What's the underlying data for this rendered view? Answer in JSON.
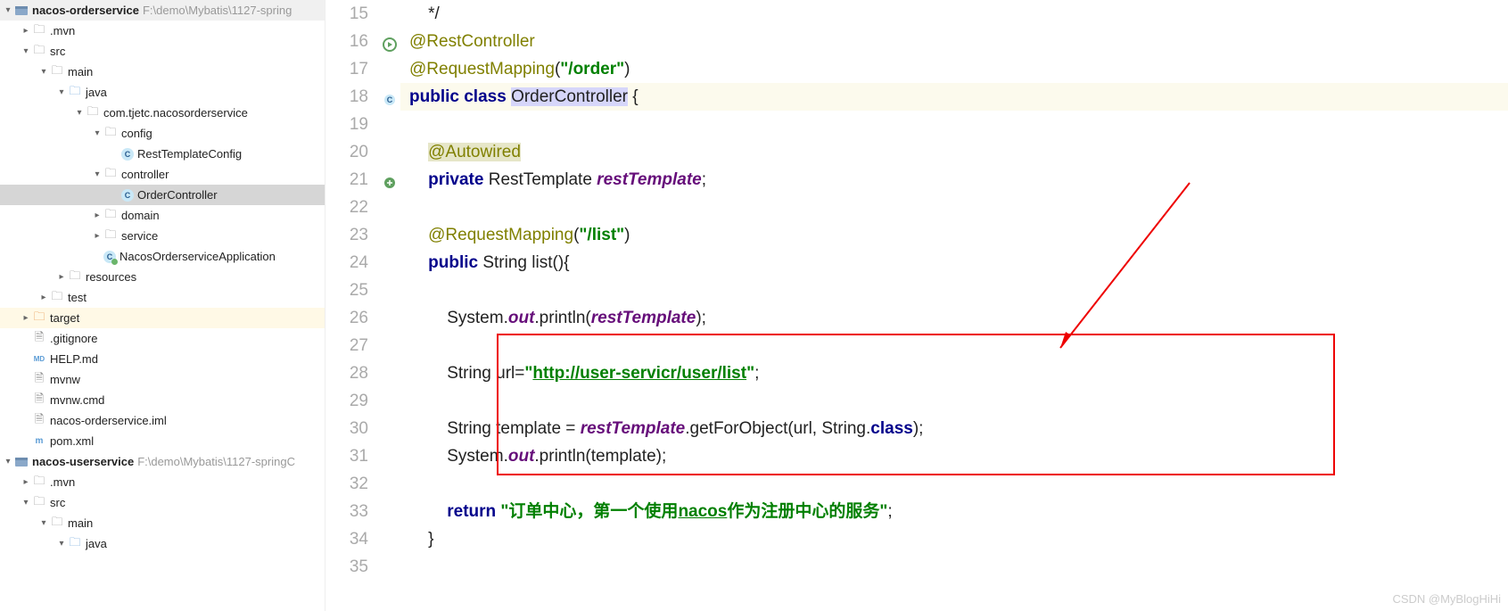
{
  "tree": {
    "proj1": {
      "name": "nacos-orderservice",
      "path": "F:\\demo\\Mybatis\\1127-spring"
    },
    "mvn": ".mvn",
    "src": "src",
    "main": "main",
    "java": "java",
    "pkg": "com.tjetc.nacosorderservice",
    "config": "config",
    "rtc": "RestTemplateConfig",
    "controller": "controller",
    "oc": "OrderController",
    "domain": "domain",
    "service": "service",
    "app": "NacosOrderserviceApplication",
    "resources": "resources",
    "test": "test",
    "target": "target",
    "gitig": ".gitignore",
    "help": "HELP.md",
    "mvnw": "mvnw",
    "mvnwcmd": "mvnw.cmd",
    "iml": "nacos-orderservice.iml",
    "pom": "pom.xml",
    "proj2": {
      "name": "nacos-userservice",
      "path": "F:\\demo\\Mybatis\\1127-springC"
    },
    "mvn2": ".mvn",
    "src2": "src",
    "main2": "main",
    "java2": "java"
  },
  "lines": [
    "15",
    "16",
    "17",
    "18",
    "19",
    "20",
    "21",
    "22",
    "23",
    "24",
    "25",
    "26",
    "27",
    "28",
    "29",
    "30",
    "31",
    "32",
    "33",
    "34",
    "35"
  ],
  "code": {
    "l15": "    */",
    "l16_ann": "@RestController",
    "l17_ann": "@RequestMapping",
    "l17_str": "\"/order\"",
    "l18_pub": "public ",
    "l18_cls": "class ",
    "l18_nm": "OrderController",
    "l18_b": " {",
    "l20_ann": "@Autowired",
    "l21_priv": "private ",
    "l21_t": "RestTemplate ",
    "l21_f": "restTemplate",
    "l23_ann": "@RequestMapping",
    "l23_str": "\"/list\"",
    "l24_pub": "public ",
    "l24_t": "String ",
    "l24_c": "list(){",
    "l26_a": "System.",
    "l26_out": "out",
    "l26_b": ".println(",
    "l26_f": "restTemplate",
    "l26_c": ");",
    "l28_a": "String url=",
    "l28_q1": "\"",
    "l28_url": "http://user-servicr/user/list",
    "l28_q2": "\"",
    "l28_c": ";",
    "l30_a": "String template = ",
    "l30_f": "restTemplate",
    "l30_b": ".getForObject(url, String.",
    "l30_cls": "class",
    "l30_c": ");",
    "l31_a": "System.",
    "l31_out": "out",
    "l31_b": ".println(template);",
    "l33_ret": "return ",
    "l33_s1": "\"订单中心，第一个使用",
    "l33_u": "nacos",
    "l33_s2": "作为注册中心的服务\"",
    "l33_c": ";",
    "l34": "}"
  },
  "watermark": "CSDN @MyBlogHiHi"
}
